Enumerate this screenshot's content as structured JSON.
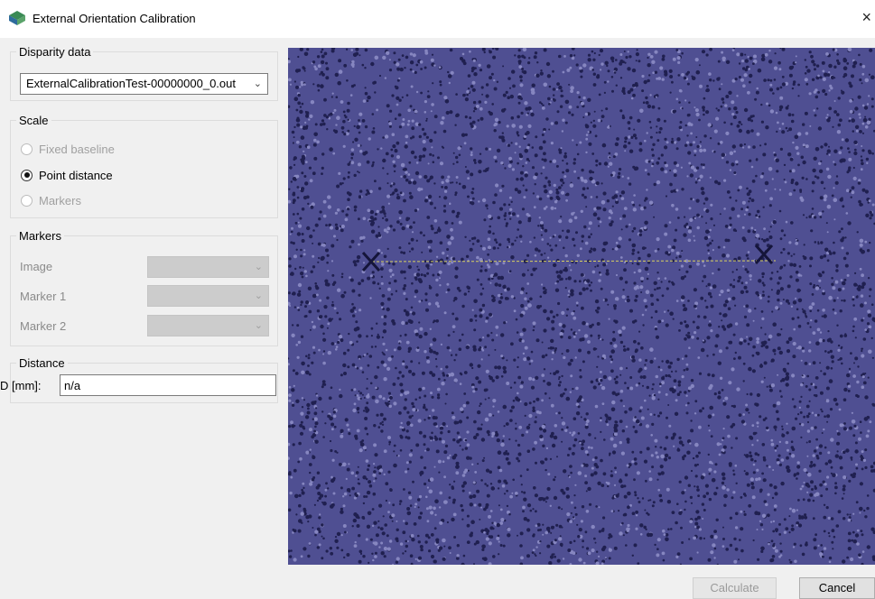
{
  "window": {
    "title": "External Orientation Calibration",
    "close_glyph": "×"
  },
  "disparity": {
    "label": "Disparity data",
    "selected": "ExternalCalibrationTest-00000000_0.out"
  },
  "scale": {
    "label": "Scale",
    "options": [
      {
        "label": "Fixed baseline",
        "selected": false,
        "enabled": false
      },
      {
        "label": "Point distance",
        "selected": true,
        "enabled": true
      },
      {
        "label": "Markers",
        "selected": false,
        "enabled": false
      }
    ]
  },
  "markers": {
    "label": "Markers",
    "rows": [
      {
        "label": "Image",
        "value": ""
      },
      {
        "label": "Marker 1",
        "value": ""
      },
      {
        "label": "Marker 2",
        "value": ""
      }
    ]
  },
  "distance": {
    "label": "Distance",
    "field_label": "D [mm]:",
    "value": "n/a"
  },
  "buttons": {
    "calculate": "Calculate",
    "cancel": "Cancel"
  },
  "colors": {
    "image_background": "#4f4f92",
    "speckle_dark": "#202050",
    "speckle_light": "#8686c0",
    "measure_line": "#d8d060",
    "point_marker": "#15153a"
  },
  "icons": {
    "app": "app-logo-icon",
    "close": "close-icon",
    "dropdown": "chevron-down-icon",
    "point": "cross-marker-icon"
  }
}
